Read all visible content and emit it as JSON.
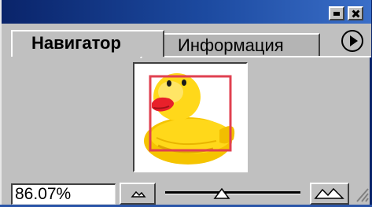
{
  "titlebar": {
    "minimize_icon": "minimize-icon",
    "close_icon": "close-icon"
  },
  "tabs": [
    {
      "label": "Навигатор",
      "active": true
    },
    {
      "label": "Информация",
      "active": false
    }
  ],
  "panel_menu_icon": "triangle-right-icon",
  "navigator": {
    "thumbnail": "rubber-duck",
    "view_box_color": "#e04050"
  },
  "zoom": {
    "value": "86.07%",
    "zoom_out_icon": "small-mountains-icon",
    "zoom_in_icon": "large-mountains-icon",
    "slider_level": 0.42
  },
  "colors": {
    "titlebar": "#0a246a",
    "panel": "#c0c0c0"
  }
}
